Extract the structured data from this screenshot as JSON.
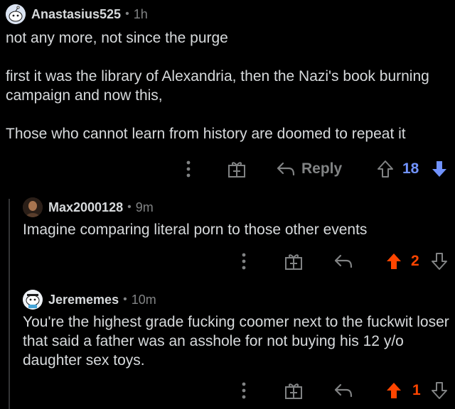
{
  "comments": [
    {
      "username": "Anastasius525",
      "time": "1h",
      "body": "not any more, not since the purge\n\nfirst it was the library of Alexandria, then the Nazi's book burning campaign and now this,\n\nThose who cannot learn from history are doomed to repeat it",
      "reply_label": "Reply",
      "score": "18",
      "vote_state": "downvoted"
    },
    {
      "username": "Max2000128",
      "time": "9m",
      "body": "Imagine comparing literal porn to those other events",
      "score": "2",
      "vote_state": "upvoted"
    },
    {
      "username": "Jerememes",
      "time": "10m",
      "body": "You're the highest grade fucking coomer next to the fuckwit loser that said a father was an asshole for not buying his 12 y/o daughter sex toys.",
      "score": "1",
      "vote_state": "upvoted"
    }
  ],
  "separator": "•",
  "colors": {
    "downvote": "#7193ff",
    "upvote": "#ff4500",
    "muted": "#818384",
    "text": "#d7dadc"
  }
}
